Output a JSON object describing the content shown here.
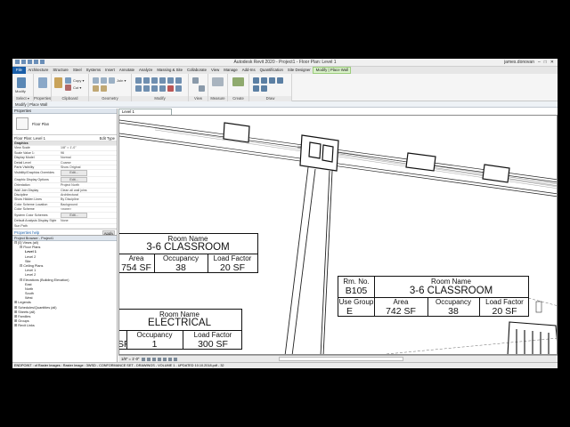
{
  "window": {
    "title": "Autodesk Revit 2020 - Project1 - Floor Plan: Level 1",
    "user": "james.donovan"
  },
  "tabs": [
    "File",
    "Architecture",
    "Structure",
    "Steel",
    "Systems",
    "Insert",
    "Annotate",
    "Analyze",
    "Massing & Site",
    "Collaborate",
    "View",
    "Manage",
    "Add-Ins",
    "Quantification",
    "Site Designer",
    "Modify | Place Wall"
  ],
  "ribbon": {
    "groups": [
      "Select",
      "Properties",
      "Clipboard",
      "Geometry",
      "Modify",
      "View",
      "Measure",
      "Create",
      "Draw"
    ],
    "select_label": "Select ▾",
    "modify_label": "Modify",
    "copy_label": "Copy ▾",
    "cut_label": "Cut ▾",
    "join_label": "Join ▾"
  },
  "options_bar": {
    "text": "Modify | Place Wall"
  },
  "properties": {
    "header": "Properties",
    "type_name": "Floor Plan",
    "instance_label": "Floor Plan: Level 1",
    "edit_type": "Edit Type",
    "rows": [
      {
        "section": "Graphics"
      },
      {
        "k": "View Scale",
        "v": "1/8\" = 1'-0\""
      },
      {
        "k": "Scale Value    1:",
        "v": "96"
      },
      {
        "k": "Display Model",
        "v": "Normal"
      },
      {
        "k": "Detail Level",
        "v": "Coarse"
      },
      {
        "k": "Parts Visibility",
        "v": "Show Original"
      },
      {
        "k": "Visibility/Graphics Overrides",
        "v": "Edit...",
        "btn": true
      },
      {
        "k": "Graphic Display Options",
        "v": "Edit...",
        "btn": true
      },
      {
        "k": "Orientation",
        "v": "Project North"
      },
      {
        "k": "Wall Join Display",
        "v": "Clean all wall joins"
      },
      {
        "k": "Discipline",
        "v": "Architectural"
      },
      {
        "k": "Show Hidden Lines",
        "v": "By Discipline"
      },
      {
        "k": "Color Scheme Location",
        "v": "Background"
      },
      {
        "k": "Color Scheme",
        "v": "<none>"
      },
      {
        "k": "System Color Schemes",
        "v": "Edit...",
        "btn": true
      },
      {
        "k": "Default Analysis Display Style",
        "v": "None"
      },
      {
        "k": "Sun Path",
        "v": ""
      }
    ],
    "help_link": "Properties help",
    "apply": "Apply"
  },
  "browser": {
    "header": "Project Browser - Project1",
    "items": [
      {
        "indent": 0,
        "text": "⊟ [0] Views (all)"
      },
      {
        "indent": 1,
        "text": "⊟ Floor Plans"
      },
      {
        "indent": 2,
        "text": "Level 1",
        "bold": true
      },
      {
        "indent": 2,
        "text": "Level 2"
      },
      {
        "indent": 2,
        "text": "Site"
      },
      {
        "indent": 1,
        "text": "⊟ Ceiling Plans"
      },
      {
        "indent": 2,
        "text": "Level 1"
      },
      {
        "indent": 2,
        "text": "Level 2"
      },
      {
        "indent": 1,
        "text": "⊟ Elevations (Building Elevation)"
      },
      {
        "indent": 2,
        "text": "East"
      },
      {
        "indent": 2,
        "text": "North"
      },
      {
        "indent": 2,
        "text": "South"
      },
      {
        "indent": 2,
        "text": "West"
      },
      {
        "indent": 0,
        "text": "⊞ Legends"
      },
      {
        "indent": 0,
        "text": "⊞ Schedules/Quantities (all)"
      },
      {
        "indent": 0,
        "text": "⊞ Sheets (all)"
      },
      {
        "indent": 0,
        "text": "⊞ Families"
      },
      {
        "indent": 0,
        "text": "⊞ Groups"
      },
      {
        "indent": 0,
        "text": "⊞ Revit Links"
      }
    ]
  },
  "view_tab": "Level 1",
  "tags": {
    "classroom_left": {
      "name_label": "Room Name",
      "name": "3-6 CLASSROOM",
      "area_label": "Area",
      "area": "754 SF",
      "occ_label": "Occupancy",
      "occ": "38",
      "load_label": "Load Factor",
      "load": "20 SF"
    },
    "classroom_b105": {
      "num_label": "Rm. No.",
      "num": "B105",
      "name_label": "Room Name",
      "name": "3-6 CLASSROOM",
      "use_label": "Use Group",
      "use": "E",
      "area_label": "Area",
      "area": "742 SF",
      "occ_label": "Occupancy",
      "occ": "38",
      "load_label": "Load Factor",
      "load": "20 SF"
    },
    "electrical": {
      "name_label": "Room Name",
      "name": "ELECTRICAL",
      "area": "SF",
      "occ_label": "Occupancy",
      "occ": "1",
      "load_label": "Load Factor",
      "load": "300 SF"
    }
  },
  "view_bar": {
    "scale": "1/8\" = 1'-0\""
  },
  "status": {
    "text": "ENDPOINT : of Raster Images : Raster Image : 3WSD - CONFORMANCE SET - DRAWINGS - VOLUME 1 - UPDATED 10.10.2018.pdf - 32"
  }
}
